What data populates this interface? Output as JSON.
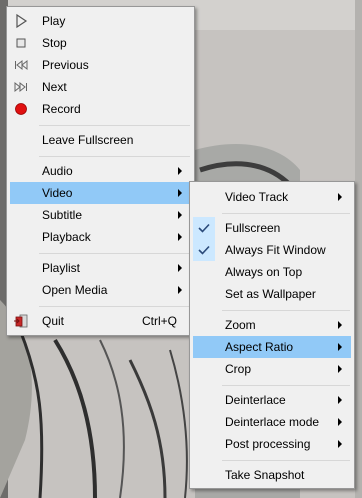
{
  "main_menu": {
    "items": [
      {
        "label": "Play",
        "icon": "play-icon",
        "submenu": false
      },
      {
        "label": "Stop",
        "icon": "stop-icon",
        "submenu": false
      },
      {
        "label": "Previous",
        "icon": "previous-icon",
        "submenu": false
      },
      {
        "label": "Next",
        "icon": "next-icon",
        "submenu": false
      },
      {
        "label": "Record",
        "icon": "record-icon",
        "submenu": false
      },
      {
        "label": "Leave Fullscreen",
        "submenu": false
      },
      {
        "label": "Audio",
        "submenu": true
      },
      {
        "label": "Video",
        "submenu": true,
        "highlighted": true
      },
      {
        "label": "Subtitle",
        "submenu": true
      },
      {
        "label": "Playback",
        "submenu": true
      },
      {
        "label": "Playlist",
        "submenu": true
      },
      {
        "label": "Open Media",
        "submenu": true
      },
      {
        "label": "Quit",
        "icon": "quit-icon",
        "shortcut": "Ctrl+Q",
        "submenu": false
      }
    ]
  },
  "video_menu": {
    "items": [
      {
        "label": "Video Track",
        "submenu": true
      },
      {
        "label": "Fullscreen",
        "checked": true
      },
      {
        "label": "Always Fit Window",
        "checked": true
      },
      {
        "label": "Always on Top",
        "checked": false
      },
      {
        "label": "Set as Wallpaper",
        "checked": false
      },
      {
        "label": "Zoom",
        "submenu": true
      },
      {
        "label": "Aspect Ratio",
        "submenu": true,
        "highlighted": true
      },
      {
        "label": "Crop",
        "submenu": true
      },
      {
        "label": "Deinterlace",
        "submenu": true
      },
      {
        "label": "Deinterlace mode",
        "submenu": true
      },
      {
        "label": "Post processing",
        "submenu": true
      },
      {
        "label": "Take Snapshot",
        "submenu": false
      }
    ]
  },
  "colors": {
    "highlight": "#91c9f7",
    "menu_bg": "#f0f0f0",
    "record_red": "#e01010",
    "check_bg": "#cce8ff"
  }
}
